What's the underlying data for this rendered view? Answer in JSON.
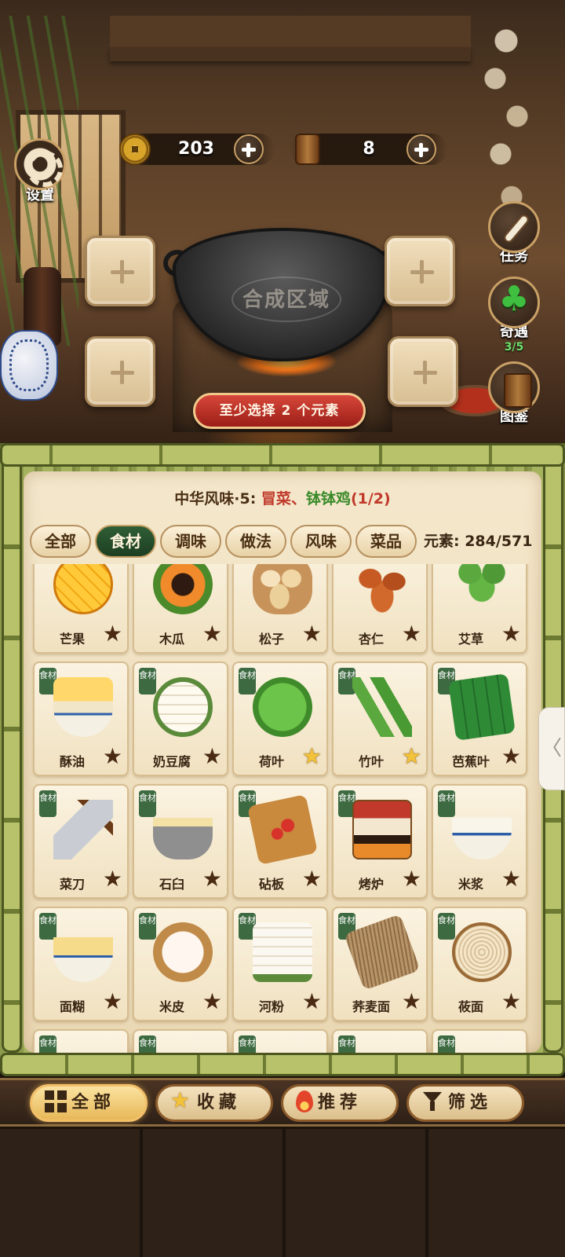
{
  "header": {
    "coins": {
      "value": "203",
      "icon": "coin-icon"
    },
    "books": {
      "value": "8",
      "icon": "recipe-book-icon"
    },
    "settings_label": "设置"
  },
  "side_buttons": {
    "task": {
      "label": "任务",
      "icon": "scroll-icon"
    },
    "encounter": {
      "label": "奇遇",
      "progress": "3/5",
      "icon": "clover-icon"
    },
    "codex": {
      "label": "图鉴",
      "icon": "book-icon"
    }
  },
  "synthesis": {
    "area_label": "合成区域",
    "hint": "至少选择 2 个元素",
    "slots": 4
  },
  "panel": {
    "recipe": {
      "prefix": "中华风味·5: ",
      "item_a": "冒菜",
      "sep": "、",
      "item_b": "钵钵鸡",
      "progress": "(1/2)"
    },
    "tabs": [
      {
        "label": "全部",
        "active": false
      },
      {
        "label": "食材",
        "active": true
      },
      {
        "label": "调味",
        "active": false
      },
      {
        "label": "做法",
        "active": false
      },
      {
        "label": "风味",
        "active": false
      },
      {
        "label": "菜品",
        "active": false
      }
    ],
    "elements_count": "元素: 284/571",
    "tag_label": "食材",
    "items": [
      {
        "name": "芒果",
        "art": "f-mango",
        "star": "dark",
        "tag": false
      },
      {
        "name": "木瓜",
        "art": "f-papaya",
        "star": "dark",
        "tag": false
      },
      {
        "name": "松子",
        "art": "f-nuts",
        "star": "dark",
        "tag": false
      },
      {
        "name": "杏仁",
        "art": "f-almond",
        "star": "dark",
        "tag": false
      },
      {
        "name": "艾草",
        "art": "f-herb",
        "star": "dark",
        "tag": false
      },
      {
        "name": "酥油",
        "art": "f-butter",
        "star": "dark",
        "tag": true
      },
      {
        "name": "奶豆腐",
        "art": "f-tofu",
        "star": "dark",
        "tag": true
      },
      {
        "name": "荷叶",
        "art": "f-lotus",
        "star": "gold",
        "tag": true
      },
      {
        "name": "竹叶",
        "art": "f-bamboo",
        "star": "gold",
        "tag": true
      },
      {
        "name": "芭蕉叶",
        "art": "f-banana",
        "star": "dark",
        "tag": true
      },
      {
        "name": "菜刀",
        "art": "f-cleaver",
        "star": "dark",
        "tag": true
      },
      {
        "name": "石臼",
        "art": "f-mortar",
        "star": "dark",
        "tag": true
      },
      {
        "name": "砧板",
        "art": "f-board",
        "star": "dark",
        "tag": true
      },
      {
        "name": "烤炉",
        "art": "f-oven",
        "star": "dark",
        "tag": true
      },
      {
        "name": "米浆",
        "art": "f-ricemilk",
        "star": "dark",
        "tag": true
      },
      {
        "name": "面糊",
        "art": "f-batter",
        "star": "dark",
        "tag": true
      },
      {
        "name": "米皮",
        "art": "f-ricesheet",
        "star": "dark",
        "tag": true
      },
      {
        "name": "河粉",
        "art": "f-noodlesheet",
        "star": "dark",
        "tag": true
      },
      {
        "name": "荞麦面",
        "art": "f-soba",
        "star": "dark",
        "tag": true
      },
      {
        "name": "莜面",
        "art": "f-oatnoodle",
        "star": "dark",
        "tag": true
      },
      {
        "name": "",
        "art": "f-generic",
        "star": "",
        "tag": true
      },
      {
        "name": "",
        "art": "f-generic",
        "star": "",
        "tag": true
      },
      {
        "name": "",
        "art": "f-generic",
        "star": "",
        "tag": true
      },
      {
        "name": "",
        "art": "f-generic",
        "star": "",
        "tag": true
      },
      {
        "name": "",
        "art": "f-generic",
        "star": "",
        "tag": true
      }
    ]
  },
  "bottom_nav": [
    {
      "label": "全部",
      "icon": "grid-icon",
      "active": true
    },
    {
      "label": "收藏",
      "icon": "star-icon",
      "active": false
    },
    {
      "label": "推荐",
      "icon": "fire-icon",
      "active": false
    },
    {
      "label": "筛选",
      "icon": "filter-icon",
      "active": false
    }
  ],
  "edge_handle": "〈",
  "colors": {
    "accent_red": "#c0392b",
    "accent_green": "#3a8a2a",
    "tab_active": "#2f5e35",
    "star_gold": "#f2c23a"
  }
}
